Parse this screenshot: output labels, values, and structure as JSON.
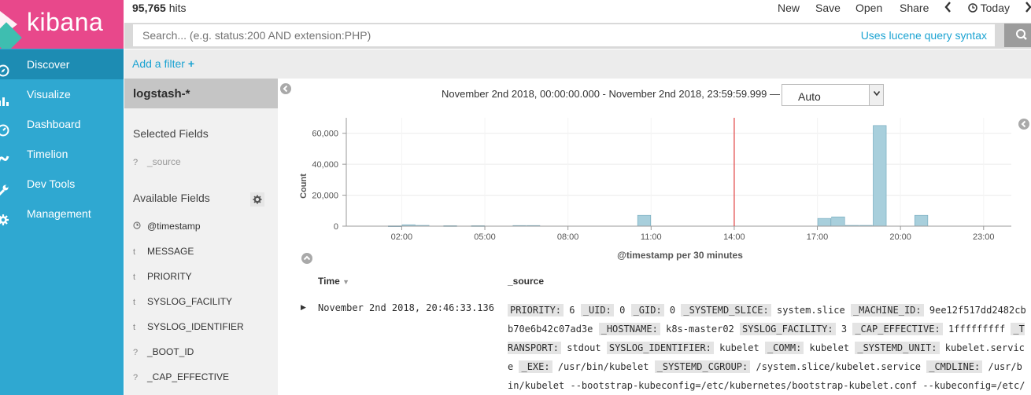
{
  "app": {
    "logo_text": "kibana"
  },
  "nav": [
    {
      "label": "Discover",
      "icon": "compass-icon",
      "active": true
    },
    {
      "label": "Visualize",
      "icon": "bar-chart-icon",
      "active": false
    },
    {
      "label": "Dashboard",
      "icon": "dashboard-icon",
      "active": false
    },
    {
      "label": "Timelion",
      "icon": "timelion-icon",
      "active": false
    },
    {
      "label": "Dev Tools",
      "icon": "wrench-icon",
      "active": false
    },
    {
      "label": "Management",
      "icon": "gear-icon",
      "active": false
    }
  ],
  "hits": {
    "count": "95,765",
    "label": "hits"
  },
  "top_menu": {
    "new": "New",
    "save": "Save",
    "open": "Open",
    "share": "Share",
    "today": "Today"
  },
  "search": {
    "placeholder": "Search... (e.g. status:200 AND extension:PHP)",
    "lucene_link": "Uses lucene query syntax"
  },
  "filter": {
    "add_label": "Add a filter"
  },
  "fields_panel": {
    "index_pattern": "logstash-*",
    "selected_title": "Selected Fields",
    "selected": [
      {
        "type": "?",
        "name": "_source"
      }
    ],
    "available_title": "Available Fields",
    "available": [
      {
        "type": "clock",
        "name": "@timestamp"
      },
      {
        "type": "t",
        "name": "MESSAGE"
      },
      {
        "type": "t",
        "name": "PRIORITY"
      },
      {
        "type": "t",
        "name": "SYSLOG_FACILITY"
      },
      {
        "type": "t",
        "name": "SYSLOG_IDENTIFIER"
      },
      {
        "type": "?",
        "name": "_BOOT_ID"
      },
      {
        "type": "?",
        "name": "_CAP_EFFECTIVE"
      }
    ]
  },
  "time_range": {
    "text": "November 2nd 2018, 00:00:00.000 - November 2nd 2018, 23:59:59.999 —",
    "interval": "Auto"
  },
  "chart_data": {
    "type": "bar",
    "ylabel": "Count",
    "xlabel": "@timestamp per 30 minutes",
    "xlim": [
      0,
      24
    ],
    "ylim": [
      0,
      70000
    ],
    "yticks": [
      0,
      20000,
      40000,
      60000
    ],
    "ytick_labels": [
      "0",
      "20,000",
      "40,000",
      "60,000"
    ],
    "xticks": [
      2,
      5,
      8,
      11,
      14,
      17,
      20,
      23
    ],
    "xtick_labels": [
      "02:00",
      "05:00",
      "08:00",
      "11:00",
      "14:00",
      "17:00",
      "20:00",
      "23:00"
    ],
    "bar_width_hours": 0.5,
    "bars": [
      {
        "x": 1.5,
        "value": 200
      },
      {
        "x": 2.0,
        "value": 900
      },
      {
        "x": 2.5,
        "value": 500
      },
      {
        "x": 3.5,
        "value": 300
      },
      {
        "x": 4.5,
        "value": 300
      },
      {
        "x": 6.0,
        "value": 400
      },
      {
        "x": 6.5,
        "value": 400
      },
      {
        "x": 10.5,
        "value": 7000
      },
      {
        "x": 17.0,
        "value": 5000
      },
      {
        "x": 17.5,
        "value": 6000
      },
      {
        "x": 18.0,
        "value": 500
      },
      {
        "x": 18.5,
        "value": 500
      },
      {
        "x": 19.0,
        "value": 65000
      },
      {
        "x": 20.5,
        "value": 7000
      }
    ],
    "now_marker_x": 14.0,
    "grid": true,
    "colors": {
      "bar": "#a8cfdc",
      "bar_stroke": "#6ea6bb",
      "now_marker": "#e04040"
    }
  },
  "doc_table": {
    "headers": {
      "time": "Time",
      "source": "_source"
    },
    "rows": [
      {
        "time": "November 2nd 2018, 20:46:33.136",
        "source": [
          [
            "PRIORITY:",
            "6"
          ],
          [
            "_UID:",
            "0"
          ],
          [
            "_GID:",
            "0"
          ],
          [
            "_SYSTEMD_SLICE:",
            "system.slice"
          ],
          [
            "_MACHINE_ID:",
            "9ee12f517dd2482cbb70e6b42c07ad3e"
          ],
          [
            "_HOSTNAME:",
            "k8s-master02"
          ],
          [
            "SYSLOG_FACILITY:",
            "3"
          ],
          [
            "_CAP_EFFECTIVE:",
            "1fffffffff"
          ],
          [
            "_TRANSPORT:",
            "stdout"
          ],
          [
            "SYSLOG_IDENTIFIER:",
            "kubelet"
          ],
          [
            "_COMM:",
            "kubelet"
          ],
          [
            "_SYSTEMD_UNIT:",
            "kubelet.service"
          ],
          [
            "_EXE:",
            "/usr/bin/kubelet"
          ],
          [
            "_SYSTEMD_CGROUP:",
            "/system.slice/kubelet.service"
          ],
          [
            "_CMDLINE:",
            "/usr/bin/kubelet --bootstrap-kubeconfig=/etc/kubernetes/bootstrap-kubelet.conf --kubeconfig=/etc/"
          ]
        ]
      }
    ]
  }
}
